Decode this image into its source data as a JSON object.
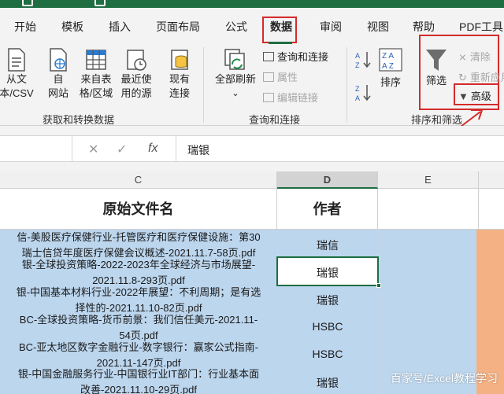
{
  "menu": {
    "tabs": [
      "开始",
      "模板",
      "插入",
      "页面布局",
      "公式",
      "数据",
      "审阅",
      "视图",
      "帮助",
      "PDF工具"
    ],
    "active": "数据"
  },
  "ribbon": {
    "get_transform": {
      "label": "获取和转换数据",
      "buttons": [
        {
          "line1": "从文",
          "line2": "本/CSV"
        },
        {
          "line1": "自",
          "line2": "网站"
        },
        {
          "line1": "来自表",
          "line2": "格/区域"
        },
        {
          "line1": "最近使",
          "line2": "用的源"
        },
        {
          "line1": "现有",
          "line2": "连接"
        }
      ]
    },
    "queries": {
      "label": "查询和连接",
      "refresh": "全部刷新",
      "items": [
        "查询和连接",
        "属性",
        "编辑链接"
      ]
    },
    "sort_filter": {
      "label": "排序和筛选",
      "sort": "排序",
      "filter": "筛选",
      "clear": "清除",
      "reapply": "重新应用",
      "advanced": "高级"
    }
  },
  "formula_bar": {
    "cancel": "✕",
    "confirm": "✓",
    "fx": "fx",
    "value": "瑞银"
  },
  "columns": {
    "c": "C",
    "d": "D",
    "e": "E"
  },
  "headers": {
    "filename": "原始文件名",
    "author": "作者"
  },
  "rows": [
    {
      "c": [
        "信-美股医疗保健行业-托管医疗和医疗保健设施：第30",
        "瑞士信贷年度医疗保健会议概述-2021.11.7-58页.pdf"
      ],
      "d": "瑞信"
    },
    {
      "c": [
        "银-全球投资策略-2022-2023年全球经济与市场展望-",
        "2021.11.8-293页.pdf"
      ],
      "d": "瑞银"
    },
    {
      "c": [
        "银-中国基本材料行业-2022年展望：不利周期；是有选",
        "择性的-2021.11.10-82页.pdf"
      ],
      "d": "瑞银"
    },
    {
      "c": [
        "BC-全球投资策略-货币前景：我们信任美元-2021.11-",
        "54页.pdf"
      ],
      "d": "HSBC"
    },
    {
      "c": [
        "BC-亚太地区数字金融行业-数字银行：赢家公式指南-",
        "2021.11-147页.pdf"
      ],
      "d": "HSBC"
    },
    {
      "c": [
        "银-中国金融服务行业-中国银行业IT部门：行业基本面",
        "改善-2021.11.10-29页.pdf"
      ],
      "d": "瑞银"
    }
  ],
  "watermark": "百家号/Excel教程学习",
  "colors": {
    "accent": "#1e6e42",
    "highlight": "#d42a2a",
    "selection": "#bcd6ee",
    "orange": "#f4b183"
  }
}
